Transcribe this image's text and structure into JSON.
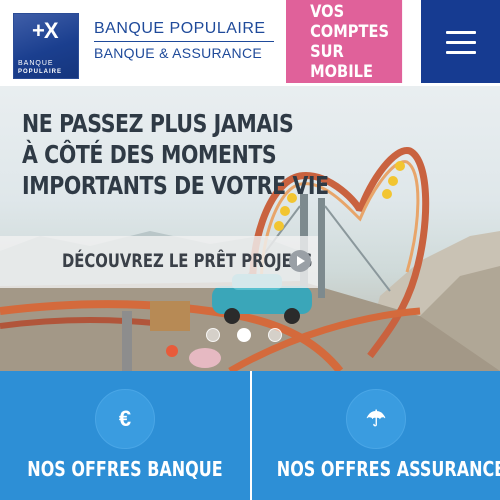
{
  "header": {
    "logo": {
      "mark": "+X",
      "line1": "BANQUE",
      "line2": "POPULAIRE"
    },
    "brand_line1": "BANQUE POPULAIRE",
    "brand_line2": "BANQUE & ASSURANCE",
    "mobile_cta_line1": "VOS COMPTES",
    "mobile_cta_line2": "SUR MOBILE",
    "menu_icon": "hamburger-icon"
  },
  "hero": {
    "headline_line1": "NE PASSEZ PLUS JAMAIS",
    "headline_line2": "À CÔTÉ DES MOMENTS",
    "headline_line3": "IMPORTANTS DE VOTRE VIE",
    "cta_label": "DÉCOUVREZ LE PRÊT PROJETS",
    "cta_icon": "play-icon",
    "carousel": {
      "slides": 3,
      "active_index": 1
    }
  },
  "offers": [
    {
      "label": "NOS OFFRES BANQUE",
      "icon": "euro-icon",
      "glyph": "€"
    },
    {
      "label": "NOS OFFRES ASSURANCE",
      "icon": "umbrella-icon",
      "glyph": "☂"
    }
  ],
  "colors": {
    "brand_blue": "#163b91",
    "pink": "#e0619a",
    "panel_blue": "#2d8fd6"
  }
}
